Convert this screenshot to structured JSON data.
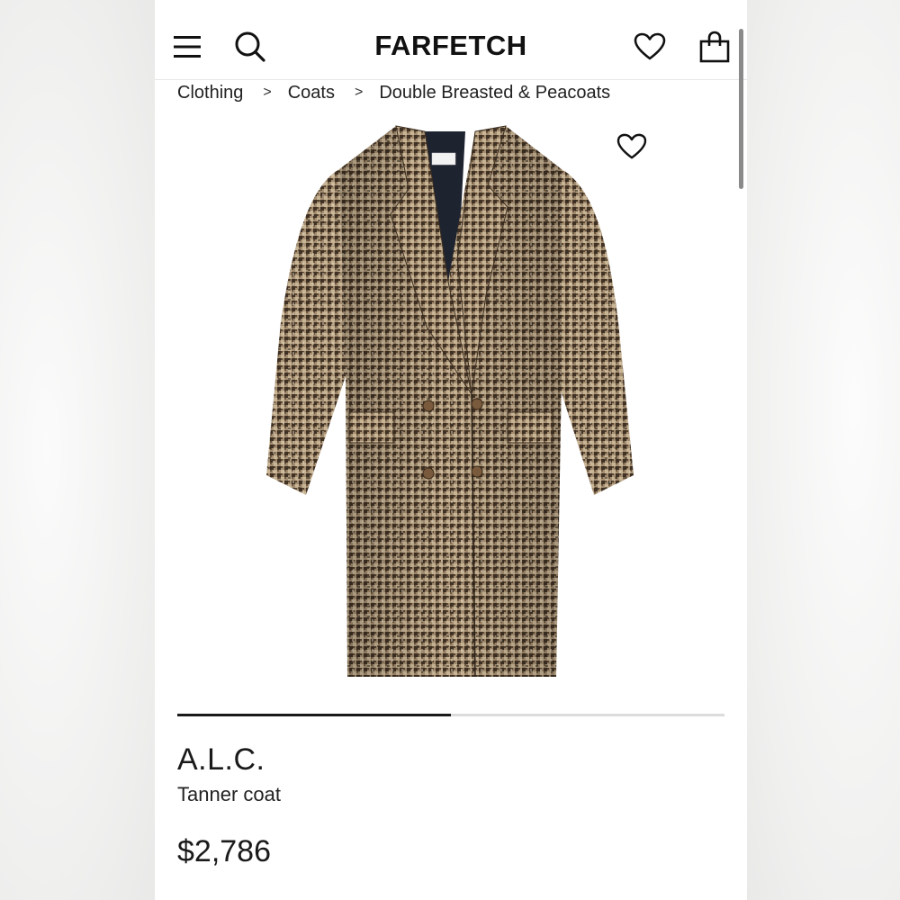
{
  "header": {
    "logo": "FARFETCH",
    "icons": [
      "menu-icon",
      "search-icon",
      "heart-icon",
      "shopping-bag-icon"
    ]
  },
  "breadcrumb": [
    {
      "label": "Clothing"
    },
    {
      "label": "Coats"
    },
    {
      "label": "Double Breasted & Peacoats"
    }
  ],
  "breadcrumb_separator": ">",
  "gallery": {
    "image": "houndstooth-double-breasted-coat",
    "progress": 0.5
  },
  "product": {
    "brand": "A.L.C.",
    "name": "Tanner coat",
    "price": "$2,786"
  },
  "colors": {
    "text": "#1a1a1a",
    "coat_base": "#8f7a60",
    "coat_dark": "#3c2f22",
    "buttons": "#7a5a3c"
  }
}
